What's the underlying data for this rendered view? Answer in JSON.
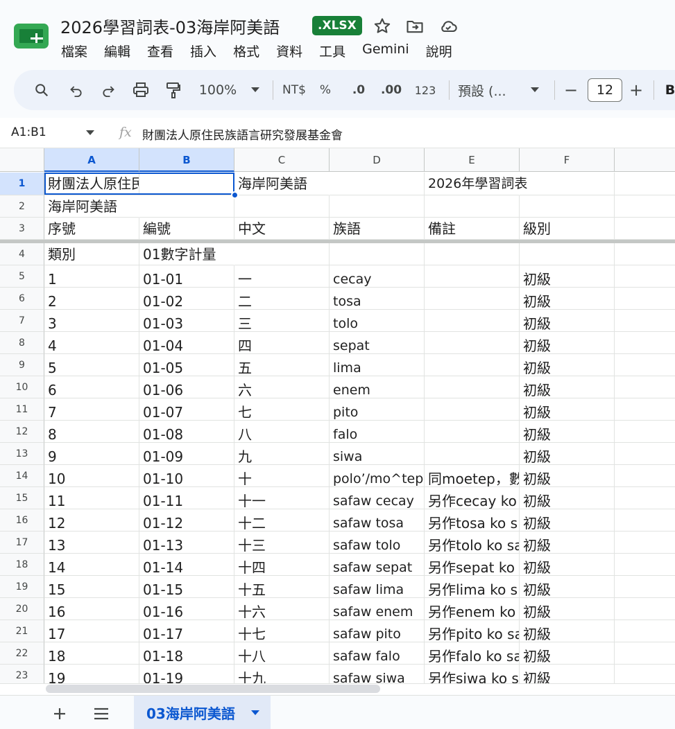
{
  "app": {
    "doc_title": "2026學習詞表-03海岸阿美語",
    "file_badge": ".XLSX",
    "brand_color": "#188038",
    "accent_color": "#0b57d0"
  },
  "menu": [
    "檔案",
    "編輯",
    "查看",
    "插入",
    "格式",
    "資料",
    "工具",
    "Gemini",
    "說明"
  ],
  "toolbar": {
    "zoom": "100%",
    "currency": "NT$",
    "percent": "%",
    "decrease_decimal": ".0",
    "increase_decimal": ".00",
    "number_format": "123",
    "font": "預設 (...",
    "font_size": "12",
    "minus": "−",
    "plus": "+",
    "bold": "B"
  },
  "formula_bar": {
    "name_box": "A1:B1",
    "fx": "fx",
    "content": "財團法人原住民族語言研究發展基金會"
  },
  "columns": [
    "A",
    "B",
    "C",
    "D",
    "E",
    "F"
  ],
  "rows": [
    {
      "num": "1",
      "cells": [
        "財團法人原住民族語言研",
        "",
        "海岸阿美語",
        "",
        "2026年學習詞表",
        ""
      ]
    },
    {
      "num": "2",
      "cells": [
        "海岸阿美語",
        "",
        "",
        "",
        "",
        ""
      ]
    },
    {
      "num": "3",
      "cells": [
        "序號",
        "編號",
        "中文",
        "族語",
        "備註",
        "級別"
      ]
    },
    {
      "num": "4",
      "cells": [
        "類別",
        "01數字計量",
        "",
        "",
        "",
        ""
      ]
    },
    {
      "num": "5",
      "cells": [
        "1",
        "01-01",
        "一",
        "cecay",
        "",
        "初級"
      ]
    },
    {
      "num": "6",
      "cells": [
        "2",
        "01-02",
        "二",
        "tosa",
        "",
        "初級"
      ]
    },
    {
      "num": "7",
      "cells": [
        "3",
        "01-03",
        "三",
        "tolo",
        "",
        "初級"
      ]
    },
    {
      "num": "8",
      "cells": [
        "4",
        "01-04",
        "四",
        "sepat",
        "",
        "初級"
      ]
    },
    {
      "num": "9",
      "cells": [
        "5",
        "01-05",
        "五",
        "lima",
        "",
        "初級"
      ]
    },
    {
      "num": "10",
      "cells": [
        "6",
        "01-06",
        "六",
        "enem",
        "",
        "初級"
      ]
    },
    {
      "num": "11",
      "cells": [
        "7",
        "01-07",
        "七",
        "pito",
        "",
        "初級"
      ]
    },
    {
      "num": "12",
      "cells": [
        "8",
        "01-08",
        "八",
        "falo",
        "",
        "初級"
      ]
    },
    {
      "num": "13",
      "cells": [
        "9",
        "01-09",
        "九",
        "siwa",
        "",
        "初級"
      ]
    },
    {
      "num": "14",
      "cells": [
        "10",
        "01-10",
        "十",
        "polo’/mo^tep",
        "同moetep，數",
        "初級"
      ]
    },
    {
      "num": "15",
      "cells": [
        "11",
        "01-11",
        "十一",
        "safaw cecay",
        "另作cecay ko",
        "初級"
      ]
    },
    {
      "num": "16",
      "cells": [
        "12",
        "01-12",
        "十二",
        "safaw tosa",
        "另作tosa ko s",
        "初級"
      ]
    },
    {
      "num": "17",
      "cells": [
        "13",
        "01-13",
        "十三",
        "safaw tolo",
        "另作tolo ko sa",
        "初級"
      ]
    },
    {
      "num": "18",
      "cells": [
        "14",
        "01-14",
        "十四",
        "safaw sepat",
        "另作sepat ko",
        "初級"
      ]
    },
    {
      "num": "19",
      "cells": [
        "15",
        "01-15",
        "十五",
        "safaw lima",
        "另作lima ko s",
        "初級"
      ]
    },
    {
      "num": "20",
      "cells": [
        "16",
        "01-16",
        "十六",
        "safaw enem",
        "另作enem ko",
        "初級"
      ]
    },
    {
      "num": "21",
      "cells": [
        "17",
        "01-17",
        "十七",
        "safaw pito",
        "另作pito ko sa",
        "初級"
      ]
    },
    {
      "num": "22",
      "cells": [
        "18",
        "01-18",
        "十八",
        "safaw falo",
        "另作falo ko sa",
        "初級"
      ]
    },
    {
      "num": "23",
      "cells": [
        "19",
        "01-19",
        "十九",
        "safaw siwa",
        "另作siwa ko s",
        "初級"
      ]
    }
  ],
  "sheets": {
    "active": "03海岸阿美語"
  },
  "icons": {
    "logo": "sheets-logo",
    "star": "star-icon",
    "move": "folder-move-icon",
    "cloud": "cloud-status-icon"
  }
}
